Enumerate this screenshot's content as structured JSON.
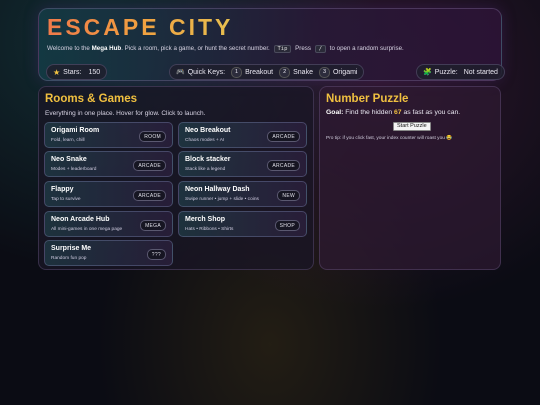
{
  "header": {
    "title": "ESCAPE CITY",
    "sub_pre": "Welcome to the",
    "sub_hub": "Mega Hub",
    "sub_mid": ". Pick a room, pick a game, or hunt the secret number.",
    "sub_tip_key": "Tip",
    "sub_press": "Press",
    "sub_key": "/",
    "sub_post": "to open a random surprise.",
    "stars_label": "Stars:",
    "stars_value": "150",
    "quick_keys_label": "Quick Keys:",
    "quick_keys": [
      {
        "key": "1",
        "label": "Breakout"
      },
      {
        "key": "2",
        "label": "Snake"
      },
      {
        "key": "3",
        "label": "Origami"
      }
    ],
    "puzzle_label": "Puzzle:",
    "puzzle_status": "Not started"
  },
  "rooms": {
    "title": "Rooms & Games",
    "description": "Everything in one place. Hover for glow. Click to launch.",
    "cards": [
      {
        "name": "Origami Room",
        "sub": "Fold, learn, chill",
        "tag": "ROOM"
      },
      {
        "name": "Neo Breakout",
        "sub": "Chaos modes + AI",
        "tag": "ARCADE"
      },
      {
        "name": "Neo Snake",
        "sub": "Modes + leaderboard",
        "tag": "ARCADE"
      },
      {
        "name": "Block stacker",
        "sub": "Stack like a legend",
        "tag": "ARCADE"
      },
      {
        "name": "Flappy",
        "sub": "Tap to survive",
        "tag": "ARCADE"
      },
      {
        "name": "Neon Hallway Dash",
        "sub": "Swipe runner • jump + slide • coins",
        "tag": "NEW"
      },
      {
        "name": "Neon Arcade Hub",
        "sub": "All mini-games in one mega page",
        "tag": "MEGA"
      },
      {
        "name": "Merch Shop",
        "sub": "Hats • Ribbons • Shirts",
        "tag": "SHOP"
      },
      {
        "name": "Surprise Me",
        "sub": "Random fun pop",
        "tag": "???"
      }
    ]
  },
  "puzzle": {
    "title": "Number Puzzle",
    "goal_label": "Goal:",
    "goal_pre": "Find the hidden",
    "goal_number": "67",
    "goal_post": "as fast as you can.",
    "button": "Start Puzzle",
    "tip": "Pro tip: if you click fast, your index counter will roast you 😂"
  },
  "icons": {
    "stars": "star-icon",
    "quick_keys": "gamepad-icon",
    "puzzle": "puzzle-icon"
  },
  "colors": {
    "accent": "#f0c040",
    "title_gradient": [
      "#f07a4a",
      "#e8c050"
    ]
  }
}
